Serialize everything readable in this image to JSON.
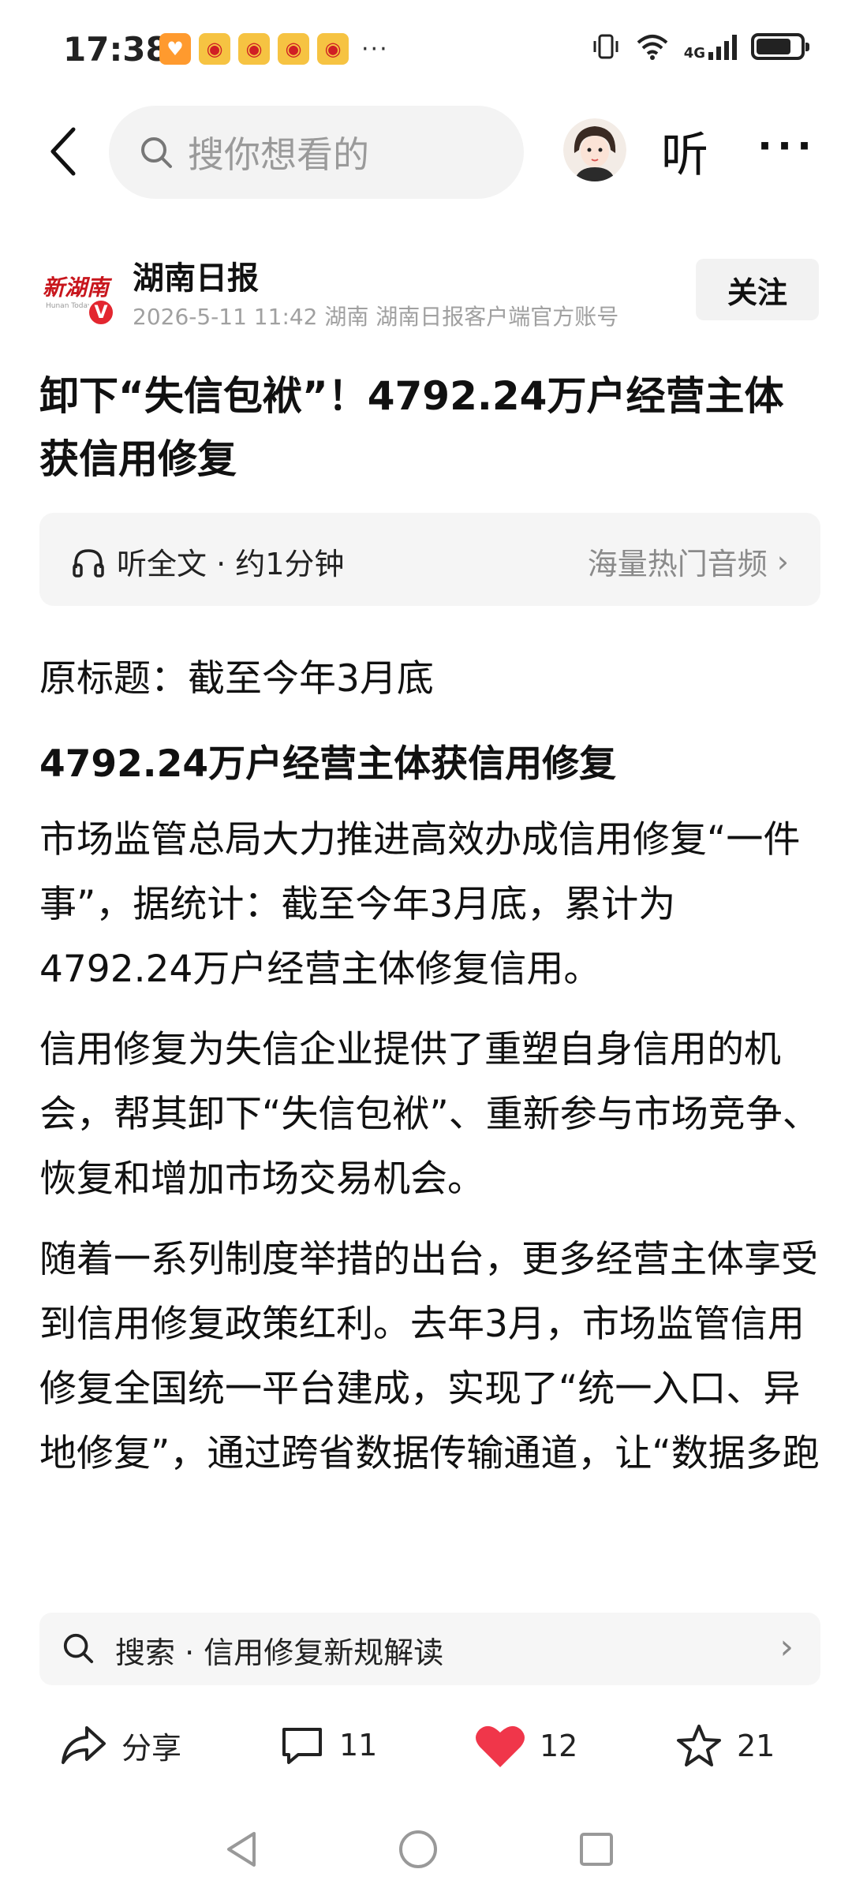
{
  "status_bar": {
    "time": "17:38",
    "notification_icons": [
      "heart-app-icon",
      "weibo-icon",
      "weibo-icon",
      "weibo-icon",
      "weibo-icon"
    ],
    "more": "···",
    "network": "4G",
    "battery_level": 0.8
  },
  "nav": {
    "search_placeholder": "搜你想看的",
    "listen_label": "听",
    "more_label": "···"
  },
  "author": {
    "logo_text": "新湖南",
    "verified_label": "V",
    "name": "湖南日报",
    "meta": "2026-5-11  11:42  湖南  湖南日报客户端官方账号",
    "follow_label": "关注"
  },
  "article": {
    "headline": "卸下“失信包袱”！4792.24万户经营主体获信用修复",
    "audio_label": "听全文 · 约1分钟",
    "audio_link": "海量热门音频",
    "subtitle_1": "原标题：截至今年3月底",
    "subtitle_2": "4792.24万户经营主体获信用修复",
    "paragraphs": [
      "市场监管总局大力推进高效办成信用修复“一件事”，据统计：截至今年3月底，累计为4792.24万户经营主体修复信用。",
      "信用修复为失信企业提供了重塑自身信用的机会，帮其卸下“失信包袱”、重新参与市场竞争、恢复和增加市场交易机会。",
      "随着一系列制度举措的出台，更多经营主体享受到信用修复政策红利。去年3月，市场监管信用修复全国统一平台建成，实现了“统一入口、异地修复”，通过跨省数据传输通道，让“数据多跑路、群众少跑腿”，极大地提高了办事效率，节约了经营主体的时间"
    ]
  },
  "related_search": {
    "text": "搜索 · 信用修复新规解读"
  },
  "actions": {
    "share_label": "分享",
    "comment_count": "11",
    "like_count": "12",
    "favorite_count": "21"
  },
  "colors": {
    "like_red": "#f0364a",
    "verified_red": "#e3262f",
    "logo_red": "#c8161d"
  }
}
